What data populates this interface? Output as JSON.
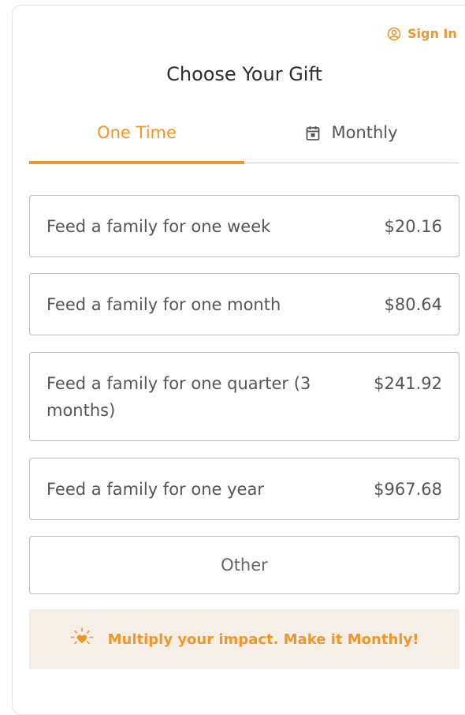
{
  "header": {
    "sign_in_label": "Sign In",
    "title": "Choose Your Gift"
  },
  "tabs": [
    {
      "label": "One Time",
      "active": true
    },
    {
      "label": "Monthly",
      "active": false
    }
  ],
  "options": [
    {
      "label": "Feed a family for one week",
      "amount": "$20.16"
    },
    {
      "label": "Feed a family for one month",
      "amount": "$80.64"
    },
    {
      "label": "Feed a family for one quarter (3 months)",
      "amount": "$241.92"
    },
    {
      "label": "Feed a family for one year",
      "amount": "$967.68"
    }
  ],
  "other_label": "Other",
  "banner": {
    "text": "Multiply your impact. Make it Monthly!",
    "icon": "heart-sparkle-icon"
  },
  "colors": {
    "accent": "#f0962b",
    "banner_bg": "#f6efe8",
    "border": "#bcbcbc"
  }
}
